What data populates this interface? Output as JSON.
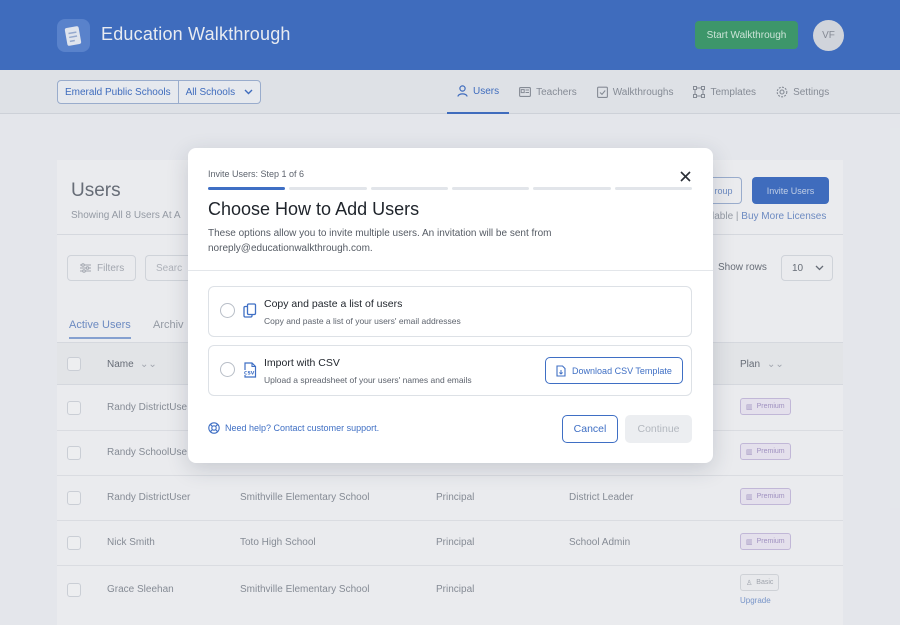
{
  "header": {
    "app_title": "Education Walkthrough",
    "start_walkthrough_label": "Start Walkthrough",
    "avatar_initials": "VF"
  },
  "nav": {
    "district": "Emerald Public Schools",
    "school_scope": "All Schools",
    "tabs": [
      {
        "label": "Users",
        "icon": "user-icon",
        "active": true
      },
      {
        "label": "Teachers",
        "icon": "id-card-icon",
        "active": false
      },
      {
        "label": "Walkthroughs",
        "icon": "clipboard-check-icon",
        "active": false
      },
      {
        "label": "Templates",
        "icon": "templates-icon",
        "active": false
      },
      {
        "label": "Settings",
        "icon": "gear-icon",
        "active": false
      }
    ]
  },
  "background": {
    "page_title": "Users",
    "subtitle": "Showing All 8 Users At A",
    "group_button_label": "roup",
    "invite_button_label": "Invite Users",
    "licenses_prefix": "lable |",
    "buy_licenses_label": "Buy More Licenses",
    "filters_label": "Filters",
    "search_placeholder": "Searc",
    "show_rows_label": "Show rows",
    "rows_value": "10",
    "tabs": [
      "Active Users",
      "Archiv"
    ],
    "columns": {
      "name": "Name",
      "plan": "Plan"
    },
    "rows": [
      {
        "name": "Randy DistrictUse",
        "school": "",
        "position": "",
        "role": "",
        "plan": "Premium"
      },
      {
        "name": "Randy SchoolUse",
        "school": "",
        "position": "",
        "role": "",
        "plan": "Premium"
      },
      {
        "name": "Randy DistrictUser",
        "school": "Smithville Elementary School",
        "position": "Principal",
        "role": "District Leader",
        "plan": "Premium"
      },
      {
        "name": "Nick Smith",
        "school": "Toto High School",
        "position": "Principal",
        "role": "School Admin",
        "plan": "Premium"
      },
      {
        "name": "Grace Sleehan",
        "school": "Smithville Elementary School",
        "position": "Principal",
        "role": "",
        "plan": "Basic",
        "upgrade": "Upgrade"
      }
    ]
  },
  "modal": {
    "step_label": "Invite Users: Step 1 of 6",
    "total_steps": 6,
    "current_step": 1,
    "title": "Choose How to Add Users",
    "description": "These options allow you to invite multiple users. An invitation will be sent from noreply@educationwalkthrough.com.",
    "options": [
      {
        "title": "Copy and paste a list of users",
        "description": "Copy and paste a list of your users' email addresses",
        "icon": "copy-icon"
      },
      {
        "title": "Import with CSV",
        "description": "Upload a spreadsheet of your users' names and emails",
        "icon": "csv-file-icon",
        "button_label": "Download CSV Template"
      }
    ],
    "help_link": "Need help? Contact customer support.",
    "cancel_label": "Cancel",
    "continue_label": "Continue"
  },
  "colors": {
    "brand": "#3f6fc4",
    "success": "#3d9c6c",
    "premium": "#a596c7"
  }
}
